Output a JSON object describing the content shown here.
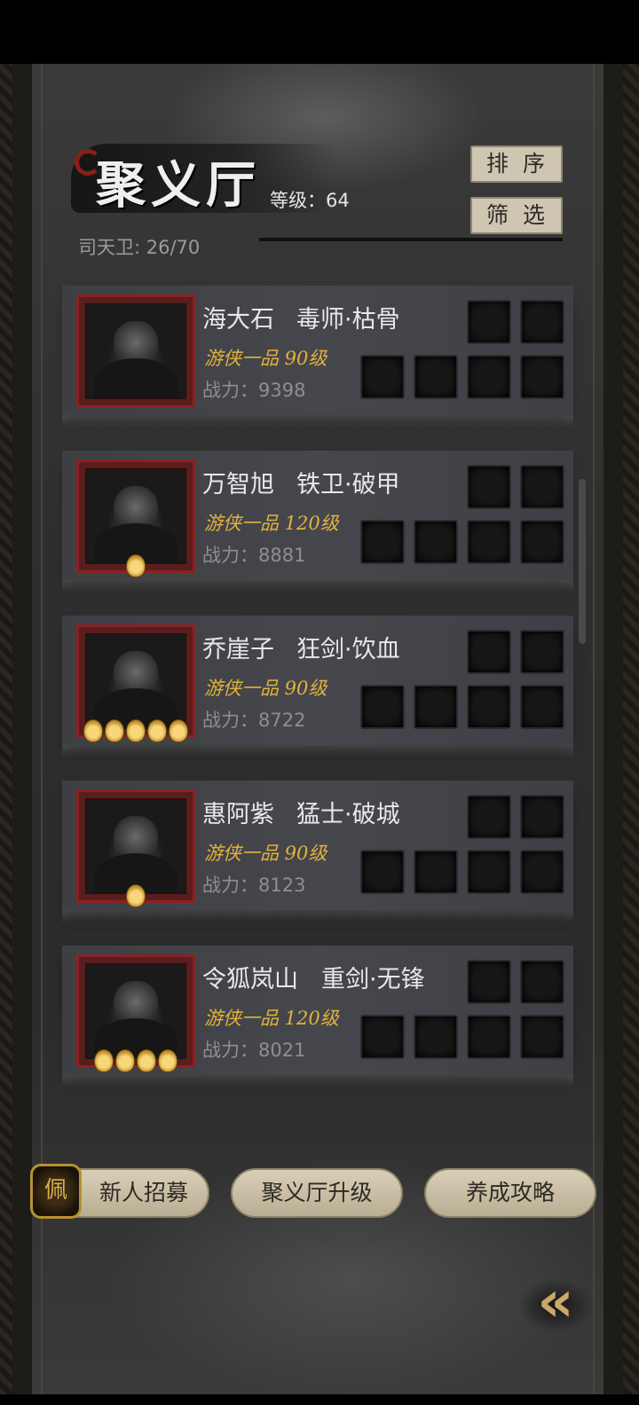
{
  "header": {
    "title": "聚义厅",
    "level_label": "等级：",
    "level_value": "64",
    "guard_count": "司天卫: 26/70",
    "sort_label": "排序",
    "filter_label": "筛选"
  },
  "heroes": [
    {
      "name": "海大石",
      "class": "毒师·枯骨",
      "rank": "游侠一品 90级",
      "power": "战力：9398",
      "stars": 0
    },
    {
      "name": "万智旭",
      "class": "铁卫·破甲",
      "rank": "游侠一品 120级",
      "power": "战力：8881",
      "stars": 1
    },
    {
      "name": "乔崖子",
      "class": "狂剑·饮血",
      "rank": "游侠一品 90级",
      "power": "战力：8722",
      "stars": 5
    },
    {
      "name": "惠阿紫",
      "class": "猛士·破城",
      "rank": "游侠一品 90级",
      "power": "战力：8123",
      "stars": 1
    },
    {
      "name": "令狐岚山",
      "class": "重剑·无锋",
      "rank": "游侠一品 120级",
      "power": "战力：8021",
      "stars": 4
    }
  ],
  "footer": {
    "recruit_label": "新人招募",
    "upgrade_label": "聚义厅升级",
    "guide_label": "养成攻略",
    "recruit_icon_glyph": "佩",
    "back_glyph": "«"
  },
  "colors": {
    "rank_gold": "#e3b23c",
    "button_beige": "#cfc6b2",
    "portrait_frame_red": "#8a2222"
  }
}
